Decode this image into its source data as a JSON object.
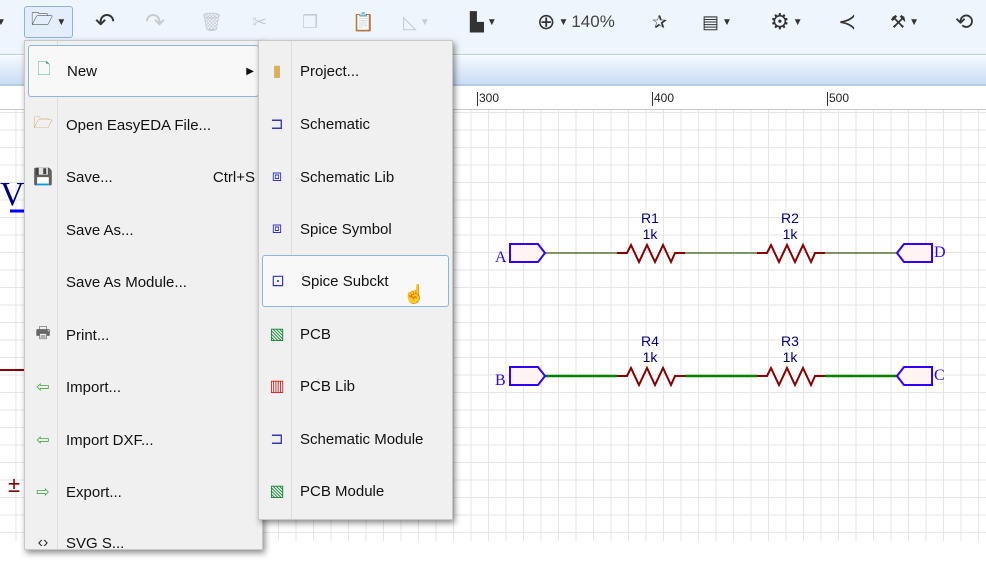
{
  "toolbar": {
    "zoom_level": "140%",
    "icons": [
      "open-folder-icon",
      "undo-icon",
      "redo-icon",
      "delete-icon",
      "cut-icon",
      "copy-icon",
      "paste-icon",
      "rotate-icon",
      "align-icon",
      "zoom-in-icon",
      "wand-icon",
      "netlist-icon",
      "gear-icon",
      "share-icon",
      "tools-icon",
      "history-icon"
    ]
  },
  "ruler": {
    "labels": [
      "300",
      "400",
      "500"
    ]
  },
  "file_menu": {
    "items": [
      {
        "label": "New",
        "icon": "new-file-icon",
        "submenu": true
      },
      {
        "label": "Open EasyEDA File...",
        "icon": "folder-open-icon"
      },
      {
        "label": "Save...",
        "icon": "floppy-icon",
        "shortcut": "Ctrl+S"
      },
      {
        "label": "Save As..."
      },
      {
        "label": "Save As Module..."
      },
      {
        "label": "Print...",
        "icon": "printer-icon"
      },
      {
        "label": "Import...",
        "icon": "import-icon"
      },
      {
        "label": "Import DXF...",
        "icon": "import-icon"
      },
      {
        "label": "Export...",
        "icon": "export-icon"
      },
      {
        "label": "SVG S...",
        "icon": "code-icon"
      }
    ]
  },
  "new_submenu": {
    "items": [
      {
        "label": "Project...",
        "icon": "project-icon"
      },
      {
        "label": "Schematic",
        "icon": "schematic-icon"
      },
      {
        "label": "Schematic Lib",
        "icon": "schematic-lib-icon"
      },
      {
        "label": "Spice Symbol",
        "icon": "spice-symbol-icon"
      },
      {
        "label": "Spice Subckt",
        "icon": "spice-subckt-icon",
        "hovered": true
      },
      {
        "label": "PCB",
        "icon": "pcb-icon"
      },
      {
        "label": "PCB Lib",
        "icon": "pcb-lib-icon"
      },
      {
        "label": "Schematic Module",
        "icon": "schematic-icon"
      },
      {
        "label": "PCB Module",
        "icon": "pcb-icon"
      }
    ]
  },
  "schematic": {
    "ports": [
      "A",
      "B",
      "C",
      "D"
    ],
    "resistors": [
      {
        "ref": "R1",
        "value": "1k"
      },
      {
        "ref": "R2",
        "value": "1k"
      },
      {
        "ref": "R4",
        "value": "1k"
      },
      {
        "ref": "R3",
        "value": "1k"
      }
    ],
    "colors": {
      "wire": "#008000",
      "resistor": "#880000",
      "port": "#3300ff",
      "label": "#000080"
    }
  }
}
